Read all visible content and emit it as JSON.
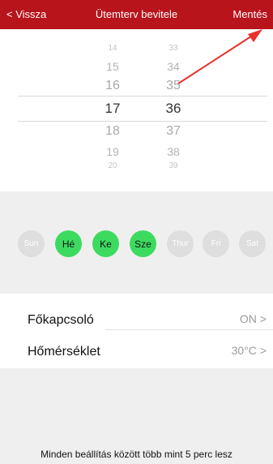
{
  "header": {
    "back_label": "< Vissza",
    "title": "Ütemterv bevitele",
    "save_label": "Mentés"
  },
  "picker": {
    "hours": [
      "14",
      "15",
      "16",
      "17",
      "18",
      "19",
      "20"
    ],
    "minutes": [
      "33",
      "34",
      "35",
      "36",
      "37",
      "38",
      "39"
    ],
    "selected_hour": "17",
    "selected_minute": "36"
  },
  "days": [
    {
      "label": "Sun",
      "selected": false
    },
    {
      "label": "Hé",
      "selected": true
    },
    {
      "label": "Ke",
      "selected": true
    },
    {
      "label": "Sze",
      "selected": true
    },
    {
      "label": "Thur",
      "selected": false
    },
    {
      "label": "Fri",
      "selected": false
    },
    {
      "label": "Sat",
      "selected": false
    }
  ],
  "settings": {
    "main_switch": {
      "label": "Főkapcsoló",
      "value": "ON >"
    },
    "temperature": {
      "label": "Hőmérséklet",
      "value": "30°C >"
    }
  },
  "footer_note": "Minden beállítás között több mint 5 perc lesz",
  "colors": {
    "header_bg": "#b8141c",
    "day_selected": "#3cdb60",
    "day_unselected": "#dedede",
    "annotation_arrow": "#e8302a"
  }
}
